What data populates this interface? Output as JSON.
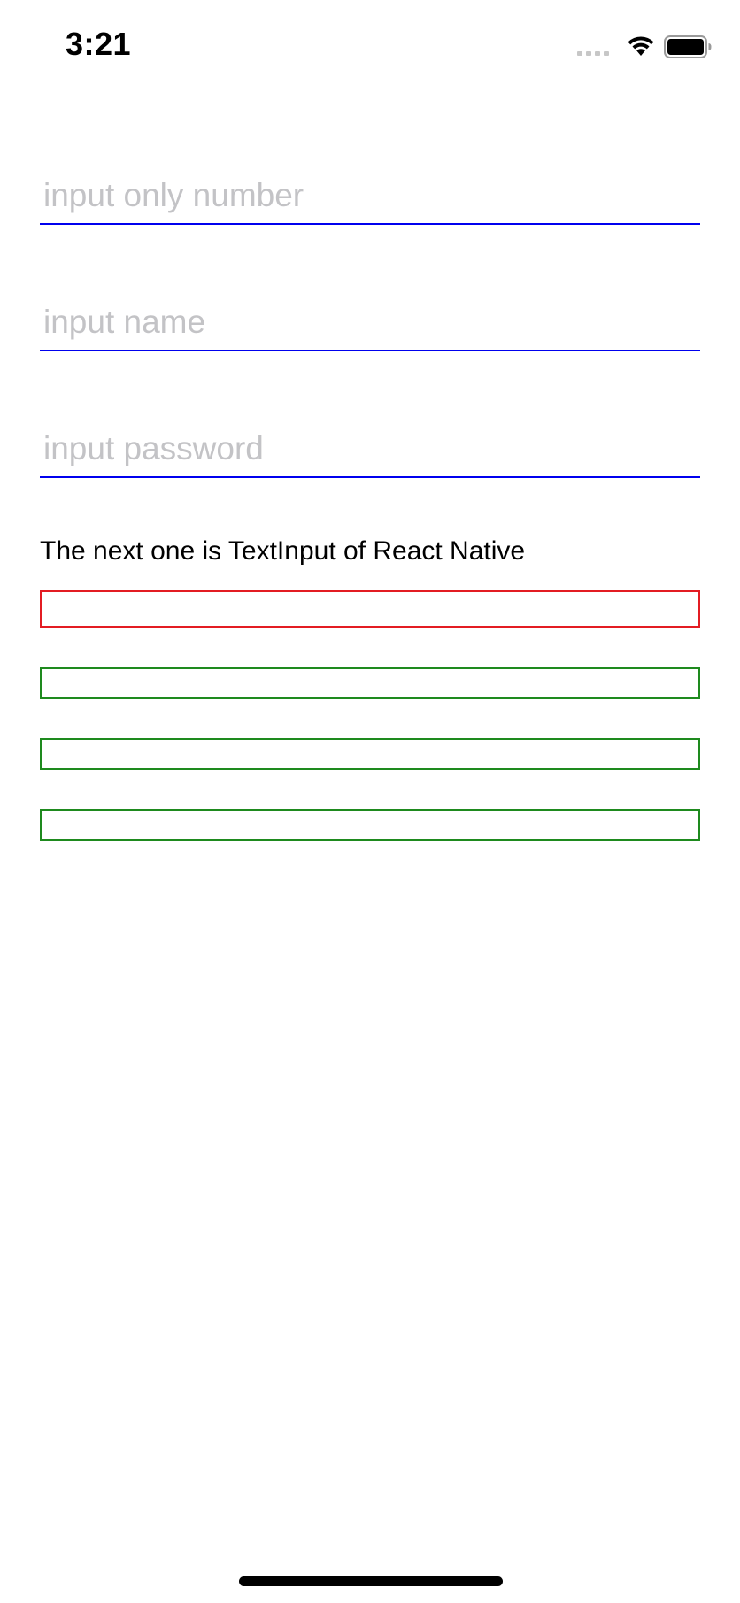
{
  "status_bar": {
    "time": "3:21",
    "signal_icon": "cellular-signal-icon",
    "wifi_icon": "wifi-icon",
    "battery_icon": "battery-icon"
  },
  "form": {
    "number_input": {
      "placeholder": "input only number",
      "value": ""
    },
    "name_input": {
      "placeholder": "input name",
      "value": ""
    },
    "password_input": {
      "placeholder": "input password",
      "value": ""
    },
    "caption": "The next one is TextInput of React Native"
  },
  "colors": {
    "underline": "#0000ee",
    "placeholder": "#c3c3c6",
    "red_border": "#e31c23",
    "green_border": "#1e8a1e"
  }
}
